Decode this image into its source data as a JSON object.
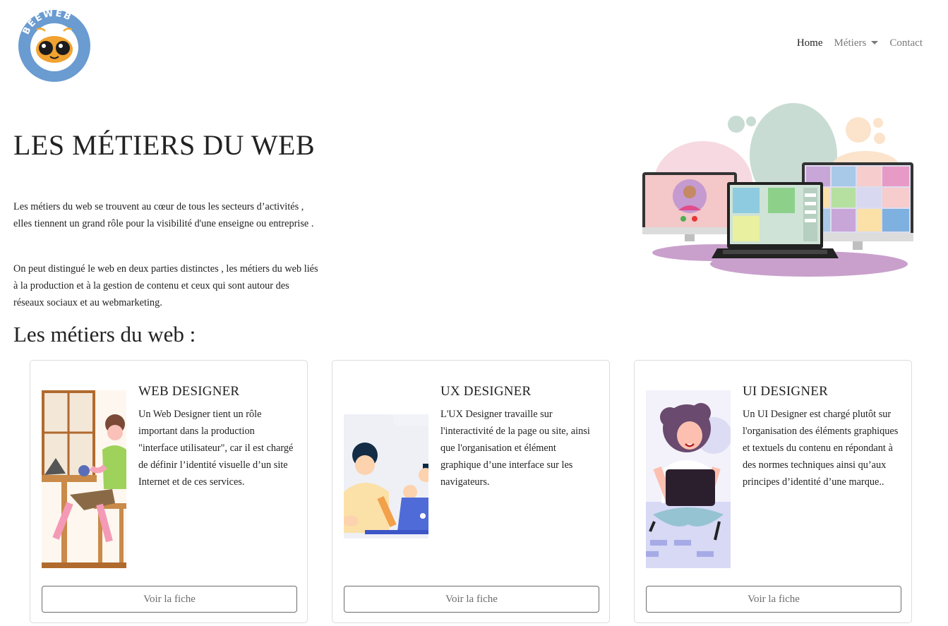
{
  "brand": {
    "logo_text": "BEEWEB",
    "logo_color": "#6a9bd1"
  },
  "nav": {
    "home_label": "Home",
    "metiers_label": "Métiers",
    "contact_label": "Contact"
  },
  "hero": {
    "title": "LES MÉTIERS DU WEB",
    "paragraph_1": "Les métiers du web se trouvent au cœur de tous les secteurs d’activités , elles tiennent un grand rôle pour la visibilité d'une enseigne ou entreprise .",
    "paragraph_2": "On peut distingué le web en deux parties distinctes , les métiers du web liés à la production et à la gestion de contenu et ceux qui sont autour des réseaux sociaux et au webmarketing."
  },
  "section": {
    "title": "Les métiers du web :"
  },
  "cards": [
    {
      "title": "WEB DESIGNER",
      "text": "Un Web Designer tient un rôle important dans la production \"interface utilisateur\", car il est chargé de définir l’identité visuelle d’un site Internet et de ces services.",
      "button": "Voir la fiche"
    },
    {
      "title": "UX DESIGNER",
      "text": "L'UX Designer travaille sur l'interactivité de la page ou site, ainsi que l'organisation et élément graphique d’une interface sur les navigateurs.",
      "button": "Voir la fiche"
    },
    {
      "title": "UI DESIGNER",
      "text": "Un UI Designer est chargé plutôt sur l'organisation des éléments graphiques et textuels du contenu en répondant à des normes techniques ainsi qu’aux principes d’identité d’une marque..",
      "button": "Voir la fiche"
    }
  ]
}
